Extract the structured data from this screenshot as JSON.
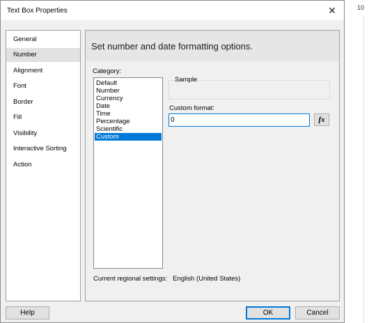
{
  "window": {
    "title": "Text Box Properties",
    "close_glyph": "✕"
  },
  "background": {
    "ruler_number": "10"
  },
  "nav": {
    "items": [
      {
        "label": "General"
      },
      {
        "label": "Number",
        "selected": true
      },
      {
        "label": "Alignment"
      },
      {
        "label": "Font"
      },
      {
        "label": "Border"
      },
      {
        "label": "Fill"
      },
      {
        "label": "Visibility"
      },
      {
        "label": "Interactive Sorting"
      },
      {
        "label": "Action"
      }
    ]
  },
  "panel": {
    "heading": "Set number and date formatting options.",
    "category_label": "Category:",
    "categories": [
      {
        "label": "Default"
      },
      {
        "label": "Number"
      },
      {
        "label": "Currency"
      },
      {
        "label": "Date"
      },
      {
        "label": "Time"
      },
      {
        "label": "Percentage"
      },
      {
        "label": "Scientific"
      },
      {
        "label": "Custom",
        "selected": true
      }
    ],
    "sample_label": "Sample",
    "custom_format_label": "Custom format:",
    "custom_format_value": "0",
    "fx_label": "fx",
    "regional_label": "Current regional settings:",
    "regional_value": "English (United States)"
  },
  "buttons": {
    "help": "Help",
    "ok": "OK",
    "cancel": "Cancel"
  },
  "colors": {
    "selection": "#0078d7",
    "dialog_bg": "#f0f0f0",
    "nav_selected": "#e1e1e1"
  }
}
